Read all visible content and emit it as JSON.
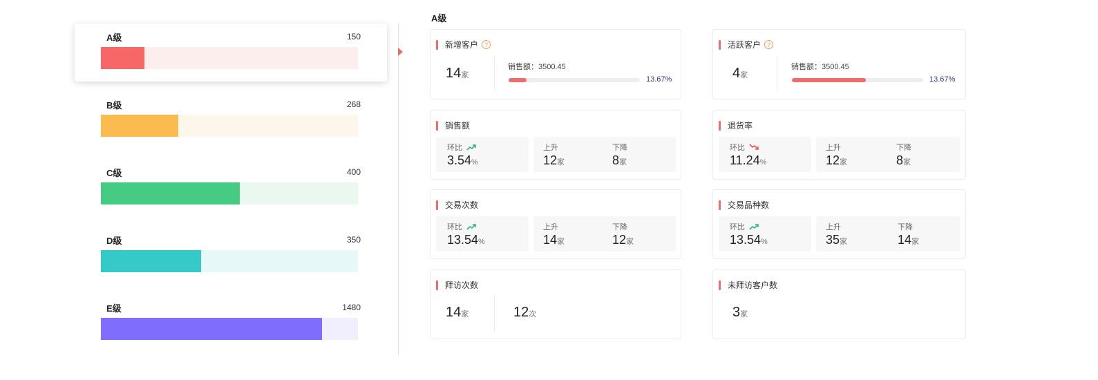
{
  "levels": [
    {
      "name": "A级",
      "count": "150",
      "ratio": 0.17,
      "color": "#f76767",
      "track": "#fdeeee"
    },
    {
      "name": "B级",
      "count": "268",
      "ratio": 0.3,
      "color": "#fcbb4f",
      "track": "#fdf6ea"
    },
    {
      "name": "C级",
      "count": "400",
      "ratio": 0.54,
      "color": "#46cb83",
      "track": "#eaf8f0"
    },
    {
      "name": "D级",
      "count": "350",
      "ratio": 0.39,
      "color": "#35cac8",
      "track": "#e7f8f8"
    },
    {
      "name": "E级",
      "count": "1480",
      "ratio": 0.86,
      "color": "#7f6efc",
      "track": "#f1effd"
    }
  ],
  "detail": {
    "title": "A级",
    "new_customers": {
      "title": "新增客户",
      "value": "14",
      "unit": "家",
      "sales_label": "销售额：3500.45",
      "progress": 0.1367,
      "pct": "13.67%"
    },
    "active_customers": {
      "title": "活跃客户",
      "value": "4",
      "unit": "家",
      "sales_label": "销售额：3500.45",
      "progress": 0.5633,
      "pct": "13.67%"
    },
    "sales": {
      "title": "销售额",
      "ratio_label": "环比",
      "ratio_value": "3.54",
      "ratio_unit": "%",
      "trend": "up",
      "up_label": "上升",
      "up_value": "12",
      "up_unit": "家",
      "down_label": "下降",
      "down_value": "8",
      "down_unit": "家"
    },
    "return_rate": {
      "title": "退货率",
      "ratio_label": "环比",
      "ratio_value": "11.24",
      "ratio_unit": "%",
      "trend": "down",
      "up_label": "上升",
      "up_value": "12",
      "up_unit": "家",
      "down_label": "下降",
      "down_value": "8",
      "down_unit": "家"
    },
    "trade_count": {
      "title": "交易次数",
      "ratio_label": "环比",
      "ratio_value": "13.54",
      "ratio_unit": "%",
      "trend": "up",
      "up_label": "上升",
      "up_value": "14",
      "up_unit": "家",
      "down_label": "下降",
      "down_value": "12",
      "down_unit": "家"
    },
    "trade_varieties": {
      "title": "交易品种数",
      "ratio_label": "环比",
      "ratio_value": "13.54",
      "ratio_unit": "%",
      "trend": "up",
      "up_label": "上升",
      "up_value": "35",
      "up_unit": "家",
      "down_label": "下降",
      "down_value": "14",
      "down_unit": "家"
    },
    "visit_count": {
      "title": "拜访次数",
      "value1": "14",
      "unit1": "家",
      "value2": "12",
      "unit2": "次"
    },
    "unvisited": {
      "title": "未拜访客户数",
      "value": "3",
      "unit": "家"
    }
  },
  "colors": {
    "accent": "#f36a6a",
    "up": "#2bb673",
    "down": "#f04f4f",
    "pct_text": "#333a80"
  },
  "icons": {
    "help": "help-circle-icon",
    "trend_up": "trend-up-icon",
    "trend_down": "trend-down-icon"
  }
}
